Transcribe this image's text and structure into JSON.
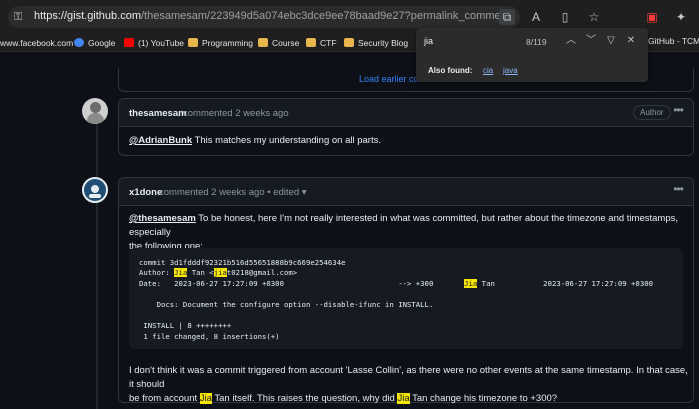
{
  "browser": {
    "url_host": "https://gist.github.com",
    "url_path": "/thesamesam/223949d5a074ebc3dce9ee78baad9e27?permalink_comment_id=5007549",
    "bookmarks": [
      {
        "label": "www.facebook.com",
        "icon": "facebook-icon"
      },
      {
        "label": "Google",
        "icon": "google-icon"
      },
      {
        "label": "(1) YouTube",
        "icon": "youtube-icon"
      },
      {
        "label": "Programming",
        "icon": "folder-icon"
      },
      {
        "label": "Course",
        "icon": "folder-icon"
      },
      {
        "label": "CTF",
        "icon": "folder-icon"
      },
      {
        "label": "Security Blog",
        "icon": "folder-icon"
      }
    ],
    "bookmark_right": "GitHub - TCM-C"
  },
  "find": {
    "query": "jia",
    "count": "8/119",
    "also_found_label": "Also found:",
    "also_found": [
      "cia",
      "java"
    ]
  },
  "page": {
    "load_earlier": "Load earlier comments...",
    "comments": [
      {
        "author": "thesamesam",
        "meta": "commented 2 weeks ago",
        "badge": "Author",
        "mention": "@AdrianBunk",
        "text": " This matches my understanding on all parts."
      },
      {
        "author": "x1done",
        "meta": "commented 2 weeks ago • edited ▾",
        "mention": "@thesamesam",
        "text_line1": " To be honest, here I'm not really interested in what was committed, but rather about the timezone and timestamps, especially",
        "text_line2": "the following one:",
        "code": {
          "commit": "commit 3d1fdddf92321b516d55651888b9c669e254634e",
          "author_pre": "Author: ",
          "author_hl1": "Jia",
          "author_mid": " Tan <",
          "author_hl2": "jia",
          "author_post": "t0218@gmail.com>",
          "date_pre": "Date:   2023-06-27 17:27:09 +0300                          --> +300       ",
          "date_hl": "Jia",
          "date_post": " Tan           2023-06-27 17:27:09 +0300",
          "docs": "    Docs: Document the configure option --disable-ifunc in INSTALL.",
          "stat1": " INSTALL | 8 ++++++++",
          "stat2": " 1 file changed, 8 insertions(+)"
        },
        "para2_line1": "I don't think it was a commit triggered from account 'Lasse Collin', as there were no other events at the same timestamp. In that case, it should",
        "para2_line2_pre": "be from account ",
        "para2_hl1": "Jia",
        "para2_line2_mid": " Tan itself. This raises the question, why did ",
        "para2_hl2": "Jia",
        "para2_line2_post": " Tan change his timezone to +300?"
      }
    ]
  }
}
